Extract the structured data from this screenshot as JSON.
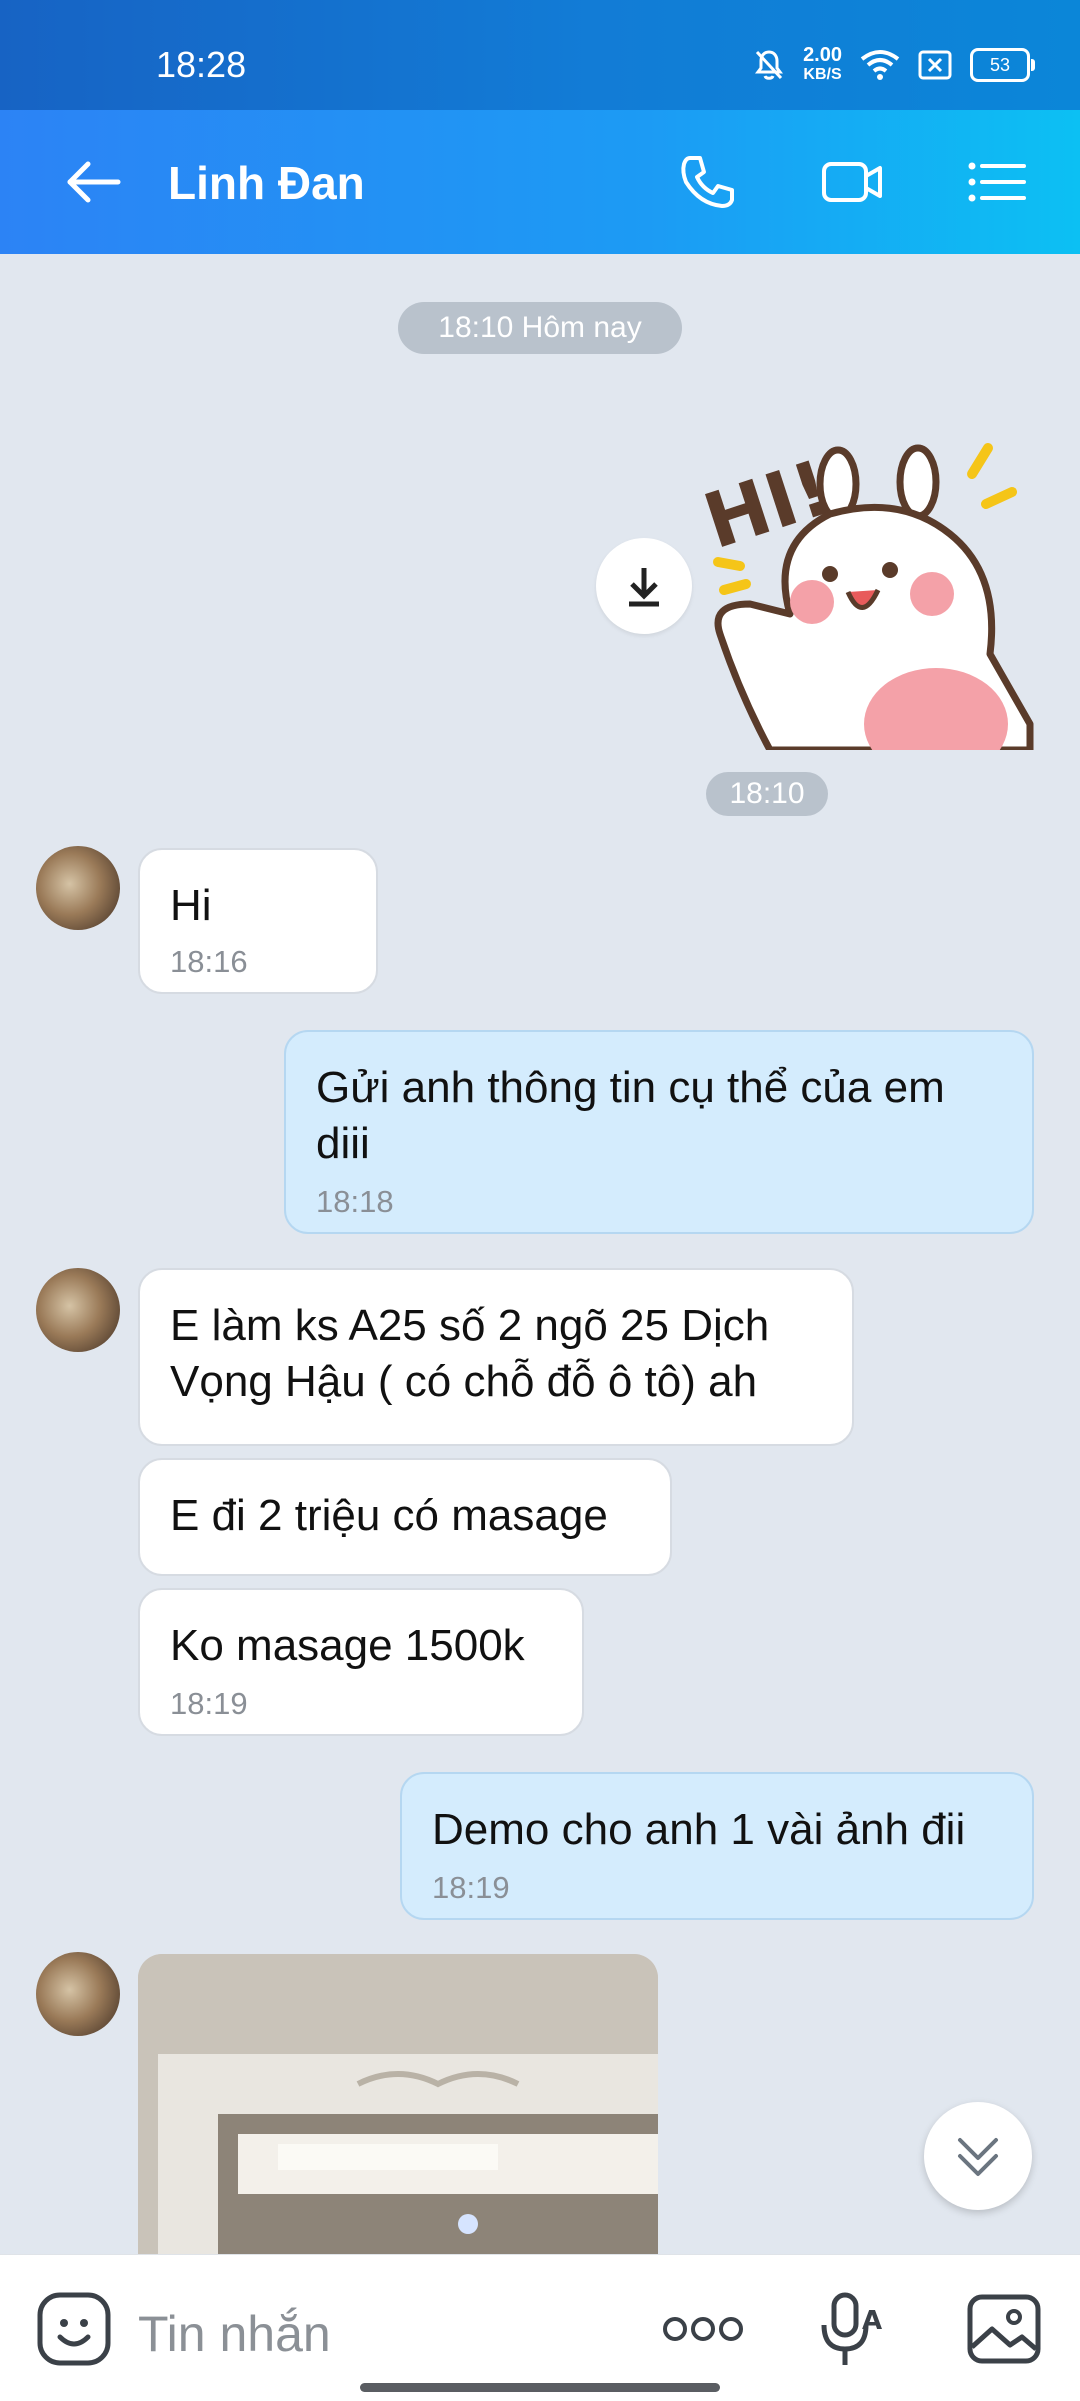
{
  "status": {
    "time": "18:28",
    "net_speed": "2.00",
    "net_unit": "KB/S",
    "battery": "53"
  },
  "header": {
    "contact_name": "Linh Đan"
  },
  "chat": {
    "date_chip": "18:10 Hôm nay",
    "sticker_time": "18:10",
    "sticker_text": "HI!",
    "messages": [
      {
        "text": "Hi",
        "time": "18:16"
      },
      {
        "text": "Gửi anh thông tin cụ thể của em diii",
        "time": "18:18"
      },
      {
        "text": "E làm ks A25 số 2 ngõ 25 Dịch Vọng Hậu ( có chỗ đỗ ô tô) ah"
      },
      {
        "text": "E đi 2 triệu có masage"
      },
      {
        "text": "Ko masage 1500k",
        "time": "18:19"
      },
      {
        "text": "Demo cho anh 1 vài ảnh đii",
        "time": "18:19"
      }
    ]
  },
  "input": {
    "placeholder": "Tin nhắn"
  },
  "colors": {
    "header": "#1c9bf4",
    "incoming": "#ffffff",
    "outgoing": "#d4ecfd",
    "background": "#e1e7ef"
  }
}
